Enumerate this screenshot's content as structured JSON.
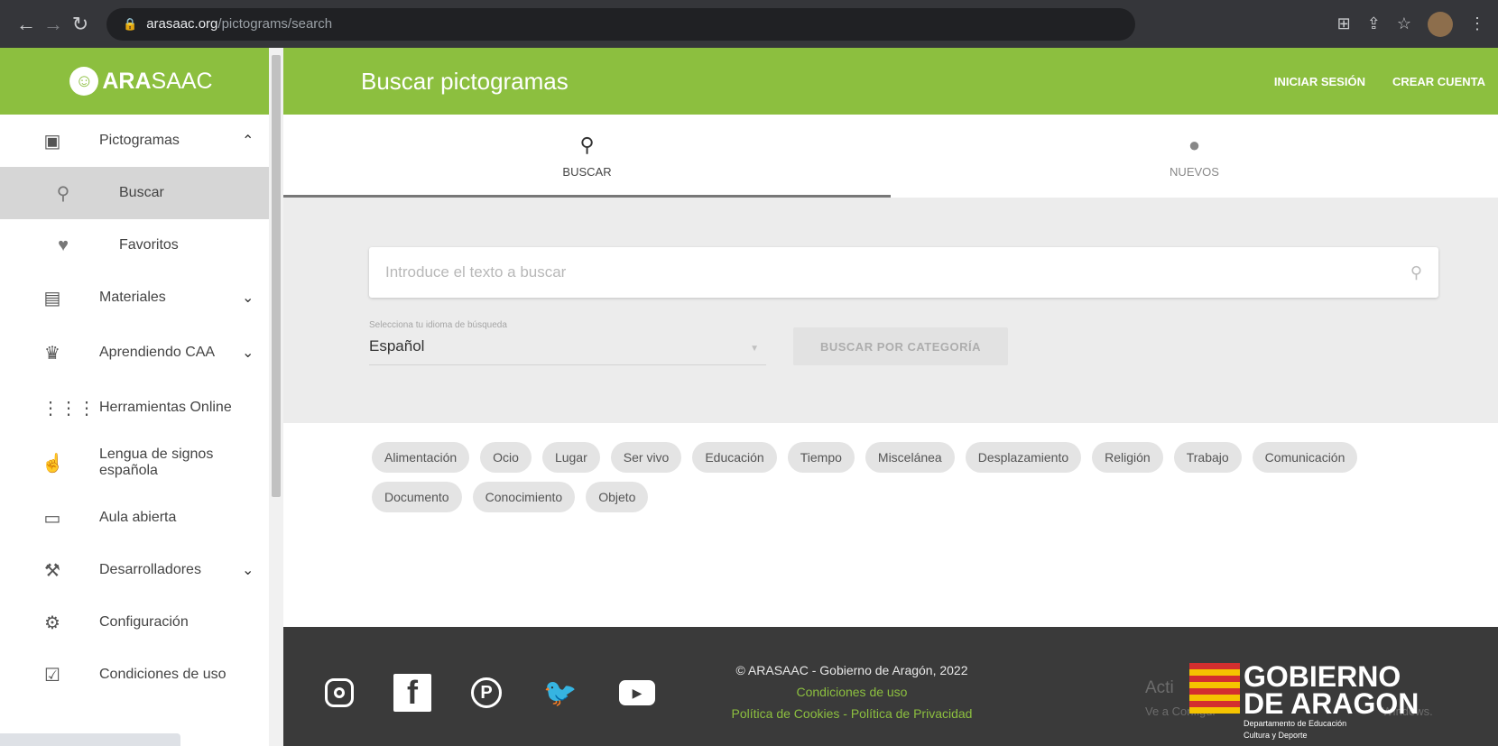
{
  "browser": {
    "url_host": "arasaac.org",
    "url_path": "/pictograms/search"
  },
  "sidebar": {
    "logo_bold": "ARA",
    "logo_rest": "SAAC",
    "items": [
      {
        "label": "Pictogramas",
        "icon": "image-icon",
        "expanded": true
      },
      {
        "label": "Buscar",
        "icon": "search-icon",
        "sub": true,
        "active": true
      },
      {
        "label": "Favoritos",
        "icon": "heart-icon",
        "sub": true
      },
      {
        "label": "Materiales",
        "icon": "book-icon"
      },
      {
        "label": "Aprendiendo CAA",
        "icon": "graduation-cap-icon"
      },
      {
        "label": "Herramientas Online",
        "icon": "grid-icon"
      },
      {
        "label": "Lengua de signos española",
        "icon": "sign-language-icon"
      },
      {
        "label": "Aula abierta",
        "icon": "classroom-icon"
      },
      {
        "label": "Desarrolladores",
        "icon": "wrench-icon"
      },
      {
        "label": "Configuración",
        "icon": "gear-icon"
      },
      {
        "label": "Condiciones de uso",
        "icon": "clipboard-icon"
      }
    ]
  },
  "header": {
    "title": "Buscar pictogramas",
    "login": "INICIAR SESIÓN",
    "signup": "CREAR CUENTA"
  },
  "tabs": [
    {
      "label": "BUSCAR",
      "icon": "search-icon",
      "active": true
    },
    {
      "label": "NUEVOS",
      "icon": "new-badge-icon",
      "active": false
    }
  ],
  "search": {
    "placeholder": "Introduce el texto a buscar",
    "lang_label": "Selecciona tu idioma de búsqueda",
    "lang_value": "Español",
    "category_button": "BUSCAR POR CATEGORÍA"
  },
  "categories": [
    "Alimentación",
    "Ocio",
    "Lugar",
    "Ser vivo",
    "Educación",
    "Tiempo",
    "Miscelánea",
    "Desplazamiento",
    "Religión",
    "Trabajo",
    "Comunicación",
    "Documento",
    "Conocimiento",
    "Objeto"
  ],
  "footer": {
    "copyright": "© ARASAAC - Gobierno de Aragón, 2022",
    "terms": "Condiciones de uso",
    "cookies": "Política de Cookies",
    "separator": " - ",
    "privacy": "Política de Privacidad",
    "gob_line1": "GOBIERNO",
    "gob_line2": "DE ARAGON",
    "gob_sub1": "Departamento de Educación",
    "gob_sub2": "Cultura y Deporte",
    "watermark_title": "Acti",
    "watermark_sub": "Ve a Configur",
    "watermark_tail": "Windows."
  },
  "colors": {
    "brand_green": "#8cbf3f",
    "footer_bg": "#3a3a3a"
  }
}
